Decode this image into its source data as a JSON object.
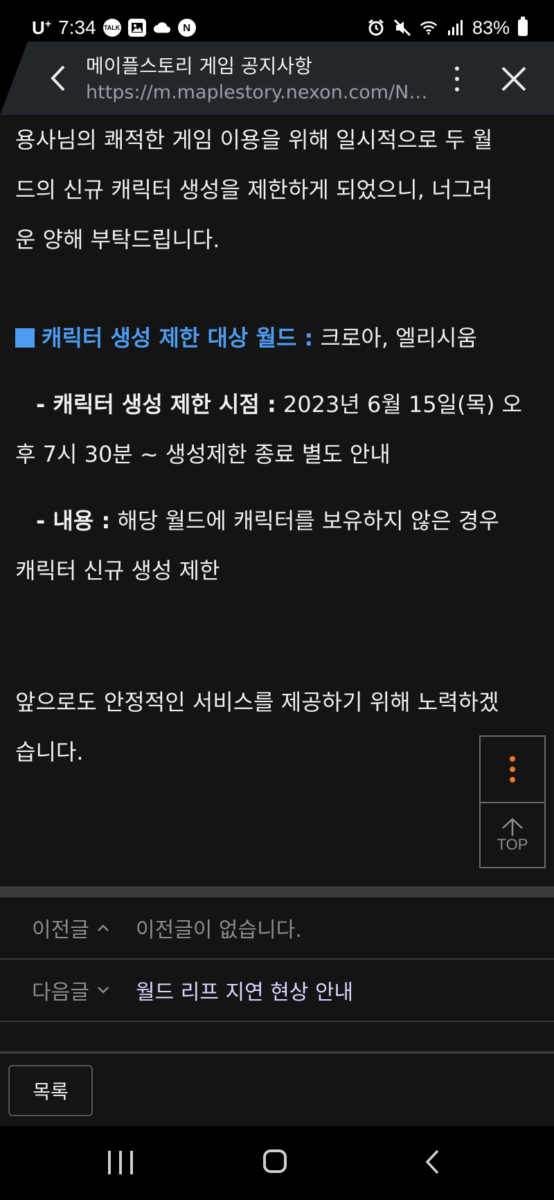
{
  "status_bar": {
    "carrier": "U",
    "carrier_plus": "+",
    "time": "7:34",
    "notification_icons": [
      "talk-icon",
      "image-icon",
      "cloud-icon",
      "naver-icon"
    ],
    "talk_label": "TALK",
    "naver_label": "N",
    "battery": "83%"
  },
  "browser": {
    "title": "메이플스토리 게임 공지사항",
    "url": "https://m.maplestory.nexon.com/Ne..."
  },
  "article": {
    "intro_line1": "용사님의 쾌적한 게임 이용을 위해 일시적으로 두 월",
    "intro_line2": "드의 신규 캐릭터 생성을 제한하게 되었으니, 너그러",
    "intro_line3": "운 양해 부탁드립니다.",
    "target_label": "캐릭터 생성 제한 대상 월드 :",
    "target_value": " 크로아, 엘리시움",
    "time_label": "- 캐릭터 생성 제한 시점 :",
    "time_value_line1": " 2023년 6월 15일(목) 오",
    "time_value_line2": "후 7시 30분 ~ 생성제한 종료 별도 안내",
    "content_label": "- 내용 :",
    "content_value_line1": " 해당 월드에 캐릭터를 보유하지 않은 경우",
    "content_value_line2": "캐릭터 신규 생성 제한",
    "closing_line1": "앞으로도 안정적인 서비스를 제공하기 위해 노력하겠",
    "closing_line2": "습니다."
  },
  "floater": {
    "top_label": "TOP",
    "more_color": "#f07a24"
  },
  "post_nav": {
    "prev_label": "이전글",
    "prev_text": "이전글이 없습니다.",
    "next_label": "다음글",
    "next_text": "월드 리프 지연 현상 안내"
  },
  "list_button": "목록",
  "colors": {
    "accent_blue": "#4d9df2",
    "background": "#141414",
    "next_link": "#dcd7ff"
  }
}
